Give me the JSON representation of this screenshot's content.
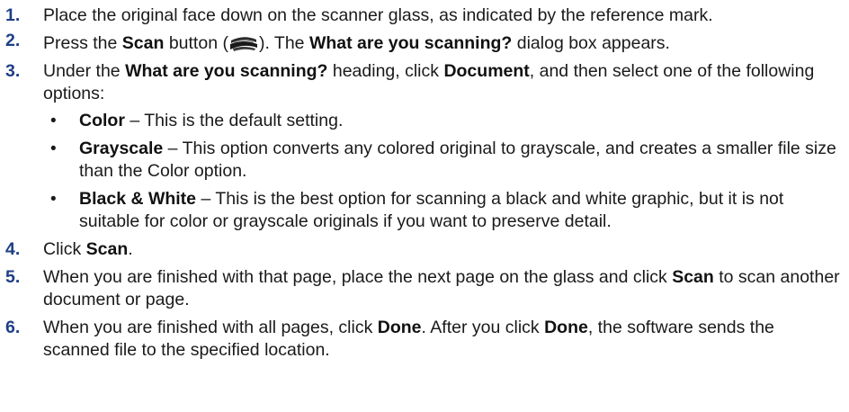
{
  "steps": [
    {
      "number": "1.",
      "text": "Place the original face down on the scanner glass, as indicated by the reference mark."
    },
    {
      "number": "2.",
      "t1": "Press the ",
      "b1": "Scan",
      "t2": " button (",
      "icon": "scan-button-icon",
      "t3": "). The ",
      "b2": "What are you scanning?",
      "t4": " dialog box appears."
    },
    {
      "number": "3.",
      "t1": "Under the ",
      "b1": "What are you scanning?",
      "t2": " heading, click ",
      "b2": "Document",
      "t3": ", and then select one of the following options:",
      "options": [
        {
          "bullet": "•",
          "label": "Color",
          "desc": " – This is the default setting."
        },
        {
          "bullet": "•",
          "label": "Grayscale",
          "desc": " – This option converts any colored original to grayscale, and creates a smaller file size than the Color option."
        },
        {
          "bullet": "•",
          "label": "Black & White",
          "desc": " – This is the best option for scanning a black and white graphic, but it is not suitable for color or grayscale originals if you want to preserve detail."
        }
      ]
    },
    {
      "number": "4.",
      "t1": "Click ",
      "b1": "Scan",
      "t2": "."
    },
    {
      "number": "5.",
      "t1": "When you are finished with that page, place the next page on the glass and click ",
      "b1": "Scan",
      "t2": " to scan another document or page."
    },
    {
      "number": "6.",
      "t1": "When you are finished with all pages, click ",
      "b1": "Done",
      "t2": ". After you click ",
      "b2": "Done",
      "t3": ", the software sends the scanned file to the specified location."
    }
  ],
  "colors": {
    "step_number": "#1f3f86",
    "text": "#1a1a1a"
  }
}
